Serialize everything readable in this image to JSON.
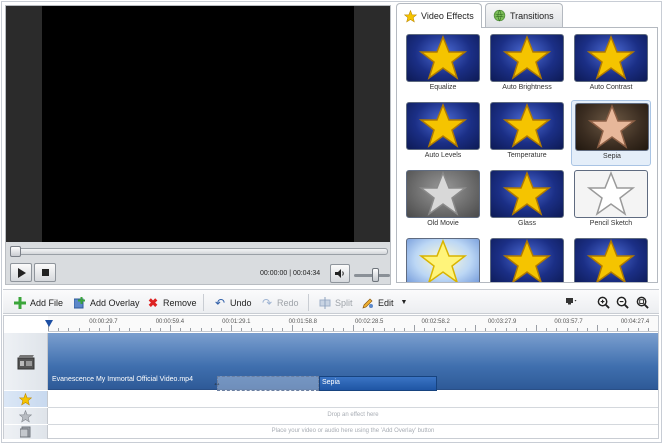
{
  "player": {
    "timecode": "00:00:00 | 00:04:34",
    "progress": 0,
    "volume": 0.55,
    "icons": {
      "play": "play-icon",
      "stop": "stop-icon",
      "volume": "speaker-icon"
    }
  },
  "tabs": [
    {
      "label": "Video Effects",
      "icon": "star-icon",
      "active": true
    },
    {
      "label": "Transitions",
      "icon": "globe-icon",
      "active": false
    }
  ],
  "effects": [
    {
      "label": "Equalize",
      "style": "blue"
    },
    {
      "label": "Auto Brightness",
      "style": "blue"
    },
    {
      "label": "Auto Contrast",
      "style": "blue"
    },
    {
      "label": "Auto Levels",
      "style": "blue"
    },
    {
      "label": "Temperature",
      "style": "blue"
    },
    {
      "label": "Sepia",
      "style": "sepia",
      "selected": true
    },
    {
      "label": "Old Movie",
      "style": "gray"
    },
    {
      "label": "Glass",
      "style": "blue"
    },
    {
      "label": "Pencil Sketch",
      "style": "white"
    },
    {
      "label": "",
      "style": "light"
    },
    {
      "label": "",
      "style": "blue"
    },
    {
      "label": "",
      "style": "blue"
    }
  ],
  "toolbar": {
    "add_file": "Add File",
    "add_overlay": "Add Overlay",
    "remove": "Remove",
    "undo": "Undo",
    "redo": "Redo",
    "split": "Split",
    "edit": "Edit"
  },
  "timeline": {
    "ticks": [
      "00:00:29.7",
      "00:00:59.4",
      "00:01:29.1",
      "00:01:58.8",
      "00:02:28.5",
      "00:02:58.2",
      "00:03:27.9",
      "00:03:57.7",
      "00:04:27.4"
    ],
    "video_clip": "Evanescence My Immortal Official Video.mp4",
    "effect_clip": "Sepia",
    "effect_hint": "Drop an effect here",
    "overlay_hint": "Place your video or audio here using the 'Add Overlay' button"
  },
  "colors": {
    "accent": "#1f55a4",
    "track": "#3f6fae",
    "star": "#f5c400"
  }
}
